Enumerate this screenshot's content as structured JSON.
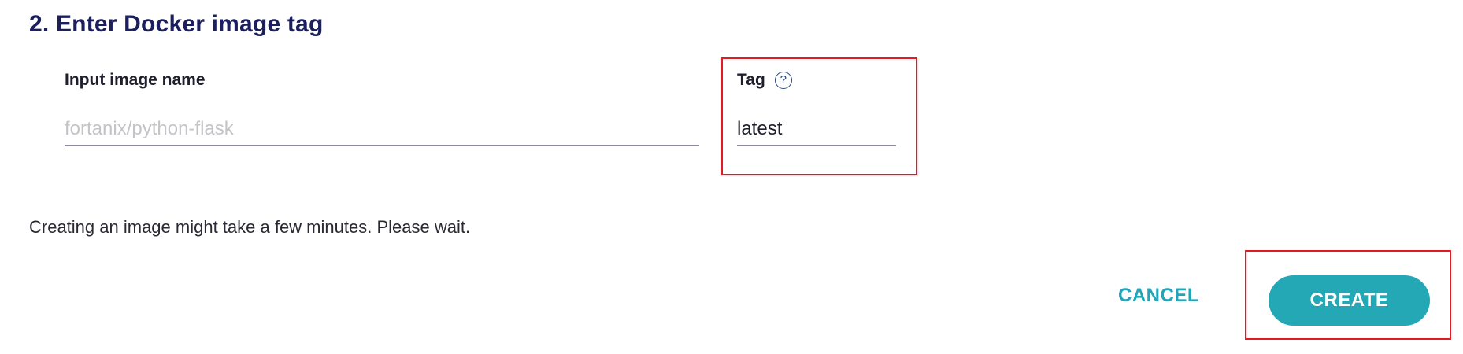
{
  "section": {
    "title": "2. Enter Docker image tag"
  },
  "image_name": {
    "label": "Input image name",
    "placeholder": "fortanix/python-flask",
    "value": ""
  },
  "tag": {
    "label": "Tag",
    "help_icon": "?",
    "value": "latest"
  },
  "notice": "Creating an image might take a few minutes. Please wait.",
  "actions": {
    "cancel_label": "CANCEL",
    "create_label": "CREATE"
  },
  "colors": {
    "accent": "#24a8b6",
    "title": "#1b1f5e",
    "highlight": "#e01b24"
  }
}
